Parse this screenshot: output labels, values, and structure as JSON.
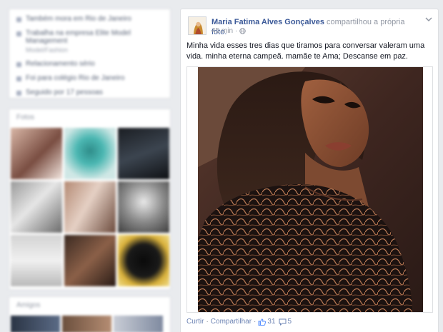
{
  "left_column": {
    "intro": {
      "items": [
        {
          "text": "Também mora em Rio de Janeiro",
          "sub": ""
        },
        {
          "text": "Trabalha na empresa Elite Model Management",
          "sub": "Model/Fashion"
        },
        {
          "text": "Relacionamento sério",
          "sub": ""
        },
        {
          "text": "Foi para colégio Rio de Janeiro",
          "sub": ""
        },
        {
          "text": "Seguido por 17 pessoas",
          "sub": ""
        }
      ]
    },
    "photos_title": "Fotos",
    "friends_title": "Amigos"
  },
  "post": {
    "author": "Maria Fatima Alves Gonçalves",
    "shared_text": "compartilhou a própria",
    "shared_link": "foto.",
    "time": "45 min",
    "text": "Minha vida esses tres dias que tiramos para conversar valeram uma vida. minha eterna campeã. mamãe te Ama; Descanse em paz.",
    "actions": {
      "like": "Curtir",
      "share": "Compartilhar",
      "likes_count": "31",
      "comments_count": "5"
    }
  },
  "colors": {
    "link": "#3b5998",
    "muted": "#9197a3",
    "background": "#e9ebee"
  },
  "icons": [
    "globe-icon",
    "chevron-down-icon",
    "like-icon",
    "comment-icon"
  ]
}
